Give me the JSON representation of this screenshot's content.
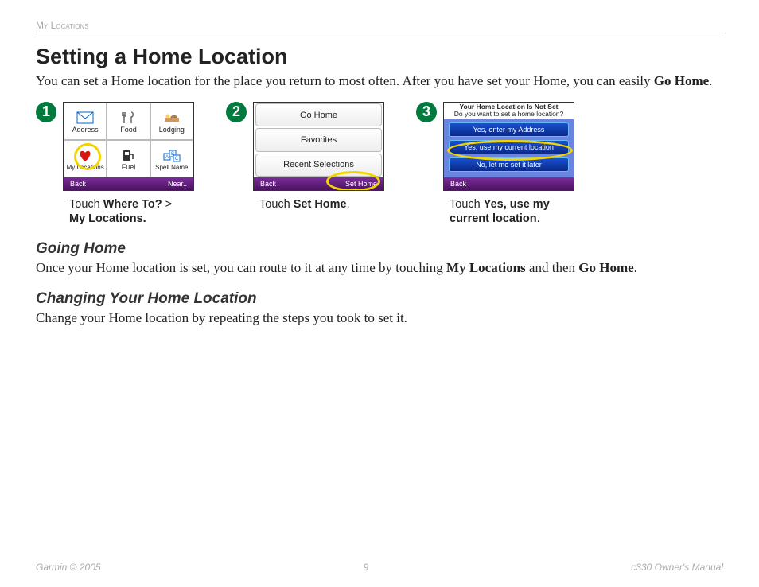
{
  "header": {
    "section": "My Locations"
  },
  "title": "Setting a Home Location",
  "intro": {
    "pre": "You can set a Home location for the place you return to most often. After you have set your Home, you can easily ",
    "bold": "Go Home",
    "post": "."
  },
  "steps": [
    {
      "num": "1",
      "screen1": {
        "cells": [
          {
            "label": "Address"
          },
          {
            "label": "Food"
          },
          {
            "label": "Lodging"
          },
          {
            "label": "My Locations"
          },
          {
            "label": "Fuel"
          },
          {
            "label": "Spell Name"
          }
        ],
        "back": "Back",
        "near": "Near.."
      },
      "caption": {
        "t1": "Touch ",
        "b1": "Where To?",
        "t2": " > ",
        "b2": "My Locations."
      }
    },
    {
      "num": "2",
      "screen2": {
        "items": [
          "Go Home",
          "Favorites",
          "Recent Selections"
        ],
        "back": "Back",
        "sethome": "Set Home"
      },
      "caption": {
        "t1": "Touch ",
        "b1": "Set Home",
        "t2": "."
      }
    },
    {
      "num": "3",
      "screen3": {
        "title1": "Your Home Location Is Not Set",
        "title2": "Do you want to set a home location?",
        "opts": [
          "Yes, enter my Address",
          "Yes, use my current location",
          "No, let me set it later"
        ],
        "back": "Back"
      },
      "caption": {
        "t1": "Touch ",
        "b1": "Yes, use my current location",
        "t2": "."
      }
    }
  ],
  "going": {
    "heading": "Going Home",
    "p_pre": "Once your Home location is set, you can route to it at any time by touching ",
    "b1": "My Locations",
    "mid": " and then ",
    "b2": "Go Home",
    "post": "."
  },
  "changing": {
    "heading": "Changing Your Home Location",
    "p": "Change your Home location by repeating the steps you took to set it."
  },
  "footer": {
    "left": "Garmin © 2005",
    "center": "9",
    "right": "c330 Owner's Manual"
  }
}
